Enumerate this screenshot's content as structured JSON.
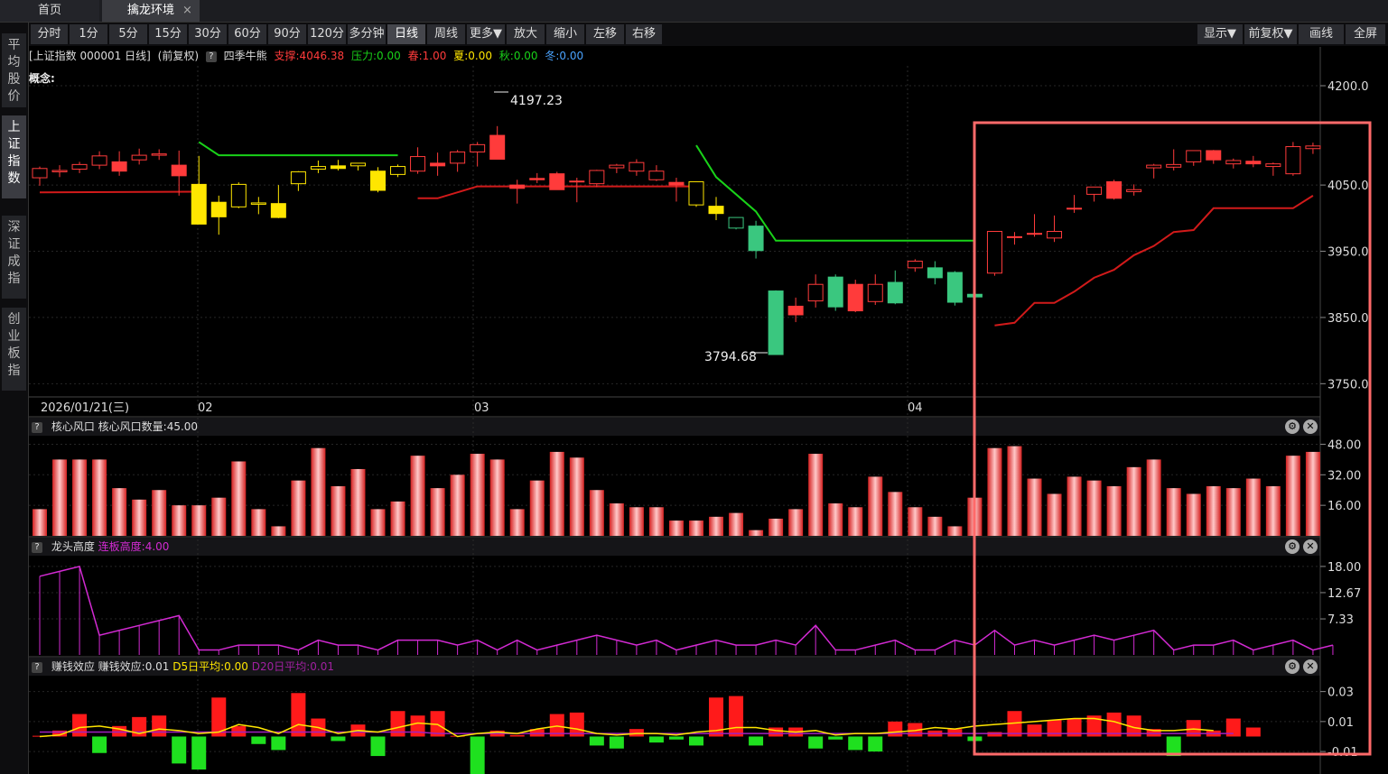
{
  "tabs": {
    "home": "首页",
    "active": "擒龙环境",
    "close_glyph": "×"
  },
  "sidebar": {
    "items": [
      "平均股价",
      "上证指数",
      "深证成指",
      "创业板指"
    ],
    "active_index": 1
  },
  "toolbar": {
    "periods": [
      "分时",
      "1分",
      "5分",
      "15分",
      "30分",
      "60分",
      "90分",
      "120分",
      "多分钟",
      "日线",
      "周线",
      "更多▼",
      "放大",
      "缩小",
      "左移",
      "右移"
    ],
    "active_period": "日线",
    "right": [
      "显示▼",
      "前复权▼",
      "画线",
      "全屏"
    ]
  },
  "info": {
    "title": "[上证指数 000001 日线]",
    "adjust": "(前复权)",
    "q": "?",
    "indicator": "四季牛熊",
    "support": "支撑:4046.38",
    "pressure": "压力:0.00",
    "spring": "春:1.00",
    "summer": "夏:0.00",
    "autumn": "秋:0.00",
    "winter": "冬:0.00",
    "concept": "概念:"
  },
  "colors": {
    "up": "#ff3b3b",
    "down": "#3ac77f",
    "yellow": "#ffe600",
    "green_line": "#19d219",
    "red_line": "#d11a1a",
    "magenta": "#d22ad2",
    "highlight": "#ff6a6a"
  },
  "chart_data": [
    {
      "type": "candlestick",
      "title": "上证指数 000001 日线",
      "ylim": [
        3730,
        4230
      ],
      "y_ticks": [
        "4200.0",
        "4050.0",
        "3950.0",
        "3850.0",
        "3750.0"
      ],
      "y_tick_values": [
        4200,
        4050,
        3950,
        3850,
        3750
      ],
      "x_labels": [
        "2026/01/21(三)",
        "02",
        "03",
        "04"
      ],
      "annotations": [
        {
          "text": "4197.23"
        },
        {
          "text": "3794.68"
        }
      ],
      "candles": [
        {
          "o": 4061,
          "h": 4078,
          "l": 4049,
          "c": 4075,
          "k": "r"
        },
        {
          "o": 4070,
          "h": 4080,
          "l": 4062,
          "c": 4072,
          "k": "r"
        },
        {
          "o": 4074,
          "h": 4085,
          "l": 4068,
          "c": 4081,
          "k": "r"
        },
        {
          "o": 4080,
          "h": 4101,
          "l": 4074,
          "c": 4094,
          "k": "r"
        },
        {
          "o": 4085,
          "h": 4101,
          "l": 4064,
          "c": 4071,
          "k": "r"
        },
        {
          "o": 4088,
          "h": 4105,
          "l": 4081,
          "c": 4095,
          "k": "r"
        },
        {
          "o": 4095,
          "h": 4104,
          "l": 4088,
          "c": 4097,
          "k": "r"
        },
        {
          "o": 4080,
          "h": 4102,
          "l": 4034,
          "c": 4064,
          "k": "r"
        },
        {
          "o": 4051,
          "h": 4094,
          "l": 4033,
          "c": 3991,
          "k": "y"
        },
        {
          "o": 4024,
          "h": 4034,
          "l": 3975,
          "c": 4002,
          "k": "y"
        },
        {
          "o": 4017,
          "h": 4054,
          "l": 4015,
          "c": 4051,
          "k": "y"
        },
        {
          "o": 4021,
          "h": 4032,
          "l": 4006,
          "c": 4023,
          "k": "y"
        },
        {
          "o": 4022,
          "h": 4050,
          "l": 4000,
          "c": 4001,
          "k": "y"
        },
        {
          "o": 4052,
          "h": 4071,
          "l": 4041,
          "c": 4070,
          "k": "y"
        },
        {
          "o": 4074,
          "h": 4087,
          "l": 4068,
          "c": 4078,
          "k": "y"
        },
        {
          "o": 4079,
          "h": 4088,
          "l": 4072,
          "c": 4075,
          "k": "y"
        },
        {
          "o": 4079,
          "h": 4083,
          "l": 4072,
          "c": 4083,
          "k": "y"
        },
        {
          "o": 4071,
          "h": 4077,
          "l": 4039,
          "c": 4042,
          "k": "y"
        },
        {
          "o": 4066,
          "h": 4081,
          "l": 4062,
          "c": 4078,
          "k": "y"
        },
        {
          "o": 4071,
          "h": 4107,
          "l": 4067,
          "c": 4093,
          "k": "r"
        },
        {
          "o": 4083,
          "h": 4099,
          "l": 4064,
          "c": 4079,
          "k": "r"
        },
        {
          "o": 4083,
          "h": 4103,
          "l": 4070,
          "c": 4100,
          "k": "r"
        },
        {
          "o": 4100,
          "h": 4115,
          "l": 4078,
          "c": 4111,
          "k": "r"
        },
        {
          "o": 4125,
          "h": 4139,
          "l": 4089,
          "c": 4089,
          "k": "r"
        },
        {
          "o": 4050,
          "h": 4058,
          "l": 4022,
          "c": 4045,
          "k": "r"
        },
        {
          "o": 4060,
          "h": 4068,
          "l": 4053,
          "c": 4058,
          "k": "r"
        },
        {
          "o": 4067,
          "h": 4070,
          "l": 4044,
          "c": 4043,
          "k": "r"
        },
        {
          "o": 4056,
          "h": 4061,
          "l": 4024,
          "c": 4056,
          "k": "r"
        },
        {
          "o": 4052,
          "h": 4073,
          "l": 4047,
          "c": 4072,
          "k": "r"
        },
        {
          "o": 4076,
          "h": 4082,
          "l": 4068,
          "c": 4080,
          "k": "r"
        },
        {
          "o": 4071,
          "h": 4089,
          "l": 4064,
          "c": 4084,
          "k": "r"
        },
        {
          "o": 4058,
          "h": 4080,
          "l": 4056,
          "c": 4071,
          "k": "r"
        },
        {
          "o": 4054,
          "h": 4061,
          "l": 4025,
          "c": 4050,
          "k": "r"
        },
        {
          "o": 4020,
          "h": 4039,
          "l": 4017,
          "c": 4055,
          "k": "y"
        },
        {
          "o": 4018,
          "h": 4032,
          "l": 3997,
          "c": 4007,
          "k": "y"
        },
        {
          "o": 3985,
          "h": 4001,
          "l": 3983,
          "c": 4001,
          "k": "g"
        },
        {
          "o": 3988,
          "h": 3996,
          "l": 3939,
          "c": 3951,
          "k": "g"
        },
        {
          "o": 3890,
          "h": 3891,
          "l": 3800,
          "c": 3794,
          "k": "g"
        },
        {
          "o": 3867,
          "h": 3880,
          "l": 3843,
          "c": 3854,
          "k": "r"
        },
        {
          "o": 3875,
          "h": 3915,
          "l": 3865,
          "c": 3900,
          "k": "r"
        },
        {
          "o": 3911,
          "h": 3915,
          "l": 3860,
          "c": 3866,
          "k": "g"
        },
        {
          "o": 3900,
          "h": 3907,
          "l": 3858,
          "c": 3860,
          "k": "r"
        },
        {
          "o": 3874,
          "h": 3915,
          "l": 3869,
          "c": 3900,
          "k": "r"
        },
        {
          "o": 3903,
          "h": 3921,
          "l": 3870,
          "c": 3872,
          "k": "g"
        },
        {
          "o": 3925,
          "h": 3938,
          "l": 3919,
          "c": 3935,
          "k": "r"
        },
        {
          "o": 3925,
          "h": 3935,
          "l": 3900,
          "c": 3910,
          "k": "g"
        },
        {
          "o": 3918,
          "h": 3920,
          "l": 3868,
          "c": 3873,
          "k": "g"
        },
        {
          "o": 3885,
          "h": 3890,
          "l": 3873,
          "c": 3881,
          "k": "g"
        },
        {
          "o": 3917,
          "h": 3924,
          "l": 3913,
          "c": 3980,
          "k": "r"
        },
        {
          "o": 3972,
          "h": 3979,
          "l": 3960,
          "c": 3972,
          "k": "r"
        },
        {
          "o": 3976,
          "h": 4006,
          "l": 3972,
          "c": 3977,
          "k": "r"
        },
        {
          "o": 3970,
          "h": 4004,
          "l": 3964,
          "c": 3980,
          "k": "r"
        },
        {
          "o": 4015,
          "h": 4035,
          "l": 4008,
          "c": 4014,
          "k": "r"
        },
        {
          "o": 4036,
          "h": 4047,
          "l": 4025,
          "c": 4047,
          "k": "r"
        },
        {
          "o": 4055,
          "h": 4058,
          "l": 4028,
          "c": 4030,
          "k": "r"
        },
        {
          "o": 4040,
          "h": 4051,
          "l": 4034,
          "c": 4043,
          "k": "r"
        },
        {
          "o": 4076,
          "h": 4082,
          "l": 4060,
          "c": 4080,
          "k": "r"
        },
        {
          "o": 4077,
          "h": 4104,
          "l": 4072,
          "c": 4081,
          "k": "r"
        },
        {
          "o": 4085,
          "h": 4099,
          "l": 4079,
          "c": 4102,
          "k": "r"
        },
        {
          "o": 4102,
          "h": 4103,
          "l": 4082,
          "c": 4088,
          "k": "r"
        },
        {
          "o": 4082,
          "h": 4090,
          "l": 4075,
          "c": 4087,
          "k": "r"
        },
        {
          "o": 4086,
          "h": 4094,
          "l": 4077,
          "c": 4082,
          "k": "r"
        },
        {
          "o": 4078,
          "h": 4084,
          "l": 4064,
          "c": 4082,
          "k": "r"
        },
        {
          "o": 4067,
          "h": 4115,
          "l": 4064,
          "c": 4108,
          "k": "r"
        },
        {
          "o": 4105,
          "h": 4114,
          "l": 4097,
          "c": 4109,
          "k": "r"
        }
      ],
      "series": [
        {
          "color": "green",
          "segments": [
            [
              [
                8,
                4115
              ],
              [
                9,
                4095
              ],
              [
                18,
                4095
              ]
            ],
            [
              [
                33,
                4110
              ],
              [
                34,
                4062
              ],
              [
                36,
                4010
              ],
              [
                37,
                3966
              ],
              [
                47,
                3966
              ]
            ]
          ]
        },
        {
          "color": "red",
          "segments": [
            [
              [
                0,
                4039
              ],
              [
                8,
                4040
              ]
            ],
            [
              [
                19,
                4030
              ],
              [
                20,
                4030
              ],
              [
                22,
                4048
              ],
              [
                33,
                4048
              ]
            ],
            [
              [
                48,
                3838
              ],
              [
                49,
                3842
              ],
              [
                50,
                3872
              ],
              [
                51,
                3872
              ],
              [
                52,
                3889
              ],
              [
                53,
                3910
              ],
              [
                54,
                3922
              ],
              [
                55,
                3944
              ],
              [
                56,
                3958
              ],
              [
                57,
                3979
              ],
              [
                58,
                3982
              ],
              [
                59,
                4015
              ],
              [
                63,
                4015
              ],
              [
                64,
                4034
              ]
            ]
          ]
        }
      ]
    },
    {
      "type": "bar",
      "title": "核心风口",
      "label": "核心风口数量:45.00",
      "ylim": [
        0,
        52
      ],
      "y_ticks": [
        "48.00",
        "32.00",
        "16.00"
      ],
      "y_tick_values": [
        48,
        32,
        16
      ],
      "values": [
        14,
        40,
        40,
        40,
        25,
        19,
        24,
        16,
        16,
        20,
        39,
        14,
        5,
        29,
        46,
        26,
        35,
        14,
        18,
        42,
        25,
        32,
        43,
        40,
        14,
        29,
        44,
        41,
        24,
        17,
        15,
        15,
        8,
        8,
        10,
        12,
        3,
        9,
        14,
        43,
        17,
        15,
        31,
        23,
        15,
        10,
        5,
        20,
        46,
        47,
        30,
        22,
        31,
        29,
        26,
        36,
        40,
        25,
        22,
        26,
        25,
        30,
        26,
        42,
        44
      ],
      "gradient": [
        "#ffc8c8",
        "#d42020"
      ]
    },
    {
      "type": "line",
      "title": "龙头高度",
      "label": "连板高度:4.00",
      "ylim": [
        0,
        20
      ],
      "y_ticks": [
        "18.00",
        "12.67",
        "7.33"
      ],
      "y_tick_values": [
        18,
        12.67,
        7.33
      ],
      "values": [
        16,
        17,
        18,
        4,
        5,
        6,
        7,
        8,
        1,
        1,
        2,
        2,
        2,
        1,
        3,
        2,
        2,
        1,
        3,
        3,
        3,
        2,
        3,
        1,
        3,
        1,
        2,
        3,
        4,
        3,
        2,
        3,
        1,
        2,
        3,
        2,
        2,
        3,
        2,
        6,
        1,
        1,
        2,
        3,
        1,
        1,
        3,
        2,
        5,
        2,
        3,
        2,
        3,
        4,
        3,
        4,
        5,
        1,
        2,
        2,
        3,
        1,
        2,
        3,
        1,
        2
      ]
    },
    {
      "type": "bar",
      "title": "赚钱效应",
      "label": "赚钱效应:0.01",
      "d5": "D5日平均:0.00",
      "d20": "D20日平均:0.01",
      "ylim": [
        -0.025,
        0.04
      ],
      "y_ticks": [
        "0.03",
        "0.01",
        "-0.01"
      ],
      "y_tick_values": [
        0.03,
        0.01,
        -0.01
      ],
      "values": [
        0.0005,
        0.004,
        0.015,
        -0.011,
        0.007,
        0.013,
        0.014,
        -0.018,
        -0.022,
        0.026,
        0.007,
        -0.005,
        -0.009,
        0.029,
        0.012,
        -0.003,
        0.008,
        -0.013,
        0.017,
        0.014,
        0.017,
        0.0005,
        -0.032,
        0.004,
        0.001,
        0.005,
        0.015,
        0.016,
        -0.006,
        -0.008,
        0.005,
        -0.004,
        -0.002,
        -0.006,
        0.026,
        0.027,
        -0.006,
        0.006,
        0.006,
        -0.008,
        -0.002,
        -0.009,
        -0.01,
        0.01,
        0.009,
        0.004,
        0.005,
        -0.003,
        0.003,
        0.017,
        0.008,
        0.011,
        0.012,
        0.014,
        0.016,
        0.014,
        0.005,
        -0.013,
        0.011,
        0.004,
        0.012,
        0.006
      ],
      "ma5": [
        0.0,
        0.001,
        0.006,
        0.007,
        0.005,
        0.002,
        0.005,
        0.004,
        0.002,
        0.003,
        0.008,
        0.006,
        0.002,
        0.008,
        0.006,
        0.002,
        0.004,
        0.003,
        0.006,
        0.009,
        0.008,
        0.0,
        0.002,
        0.003,
        0.002,
        0.005,
        0.007,
        0.005,
        0.002,
        0.001,
        0.002,
        0.002,
        0.001,
        0.003,
        0.004,
        0.006,
        0.006,
        0.004,
        0.003,
        0.004,
        0.001,
        0.002,
        0.002,
        0.003,
        0.004,
        0.006,
        0.005,
        0.007,
        0.008,
        0.009,
        0.01,
        0.011,
        0.012,
        0.012,
        0.01,
        0.006,
        0.004,
        0.004,
        0.005,
        0.004
      ],
      "ma20": [
        0.003,
        0.003,
        0.003,
        0.003,
        0.003,
        0.003,
        0.003,
        0.003,
        0.003,
        0.003,
        0.003,
        0.003,
        0.003,
        0.003,
        0.003,
        0.003,
        0.003,
        0.003,
        0.003,
        0.003,
        0.002,
        0.002,
        0.002,
        0.002,
        0.002,
        0.002,
        0.002,
        0.002,
        0.002,
        0.002,
        0.002,
        0.002,
        0.002,
        0.002,
        0.002,
        0.002,
        0.002,
        0.002,
        0.002,
        0.002,
        0.002,
        0.002,
        0.002,
        0.002,
        0.002,
        0.002,
        0.002,
        0.002,
        0.002,
        0.002,
        0.002,
        0.002,
        0.002,
        0.002,
        0.002,
        0.002,
        0.002,
        0.002,
        0.002,
        0.002,
        0.002
      ]
    }
  ]
}
